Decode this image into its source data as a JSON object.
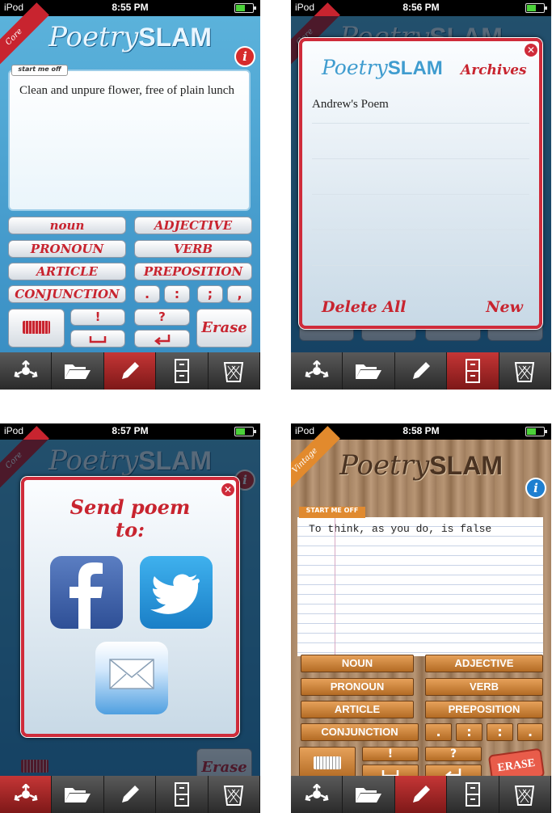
{
  "status_bars": [
    {
      "carrier": "iPod",
      "time": "8:55 PM"
    },
    {
      "carrier": "iPod",
      "time": "8:56 PM"
    },
    {
      "carrier": "iPod",
      "time": "8:57 PM"
    },
    {
      "carrier": "iPod",
      "time": "8:58 PM"
    }
  ],
  "logo": {
    "part1": "Poetry",
    "part2": "SLAM"
  },
  "themes": {
    "core": "Core",
    "vintage": "Vintage"
  },
  "info_label": "i",
  "start_label": "start me off",
  "vintage_start_label": "START ME OFF",
  "poems": {
    "core": "Clean and unpure flower, free of plain lunch",
    "vintage": "To think, as you do, is false"
  },
  "word_buttons": {
    "noun": "noun",
    "adjective": "ADJECTIVE",
    "pronoun": "PRONOUN",
    "verb": "VERB",
    "article": "ARTICLE",
    "preposition": "PREPOSITION",
    "conjunction": "CONJUNCTION"
  },
  "vintage_word_buttons": {
    "noun": "NOUN",
    "adjective": "ADJECTIVE",
    "pronoun": "PRONOUN",
    "verb": "VERB",
    "article": "ARTICLE",
    "preposition": "PREPOSITION",
    "conjunction": "CONJUNCTION"
  },
  "punctuation": [
    ".",
    ":",
    ";",
    ","
  ],
  "vintage_punctuation": [
    ".",
    ":",
    ":",
    "."
  ],
  "keys": {
    "exclaim": "!",
    "question": "?",
    "erase": "Erase",
    "vintage_erase": "ERASE"
  },
  "archives": {
    "title": "Archives",
    "items": [
      "Andrew's Poem"
    ],
    "delete_all": "Delete All",
    "new": "New"
  },
  "share": {
    "title": "Send poem to:"
  },
  "close_label": "✕",
  "tab_icons": [
    "share-icon",
    "folder-icon",
    "pencil-icon",
    "cabinet-icon",
    "trash-icon"
  ],
  "colors": {
    "accent_red": "#c8242f",
    "core_blue": "#3a8fc4",
    "vintage_orange": "#e28a2d"
  }
}
